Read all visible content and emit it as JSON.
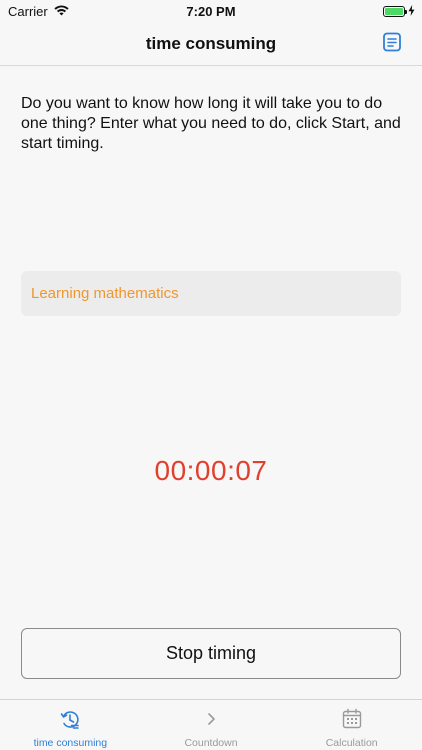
{
  "status_bar": {
    "carrier": "Carrier",
    "time": "7:20 PM",
    "battery_level": 1.0
  },
  "nav": {
    "title": "time consuming",
    "action_icon": "notes-icon"
  },
  "intro_text": "Do you want to know how long it will take you to do one thing? Enter what you need to do, click Start, and start timing.",
  "task": {
    "value": "Learning mathematics",
    "placeholder": ""
  },
  "timer": {
    "display": "00:00:07"
  },
  "stop_button": {
    "label": "Stop timing"
  },
  "tabs": [
    {
      "label": "time consuming",
      "icon": "timer-history-icon",
      "active": true
    },
    {
      "label": "Countdown",
      "icon": "chevron-right-icon",
      "active": false
    },
    {
      "label": "Calculation",
      "icon": "calendar-icon",
      "active": false
    }
  ],
  "colors": {
    "accent": "#2f7fd8",
    "task_text": "#f0962d",
    "timer": "#e0412f",
    "battery": "#4cd964"
  }
}
